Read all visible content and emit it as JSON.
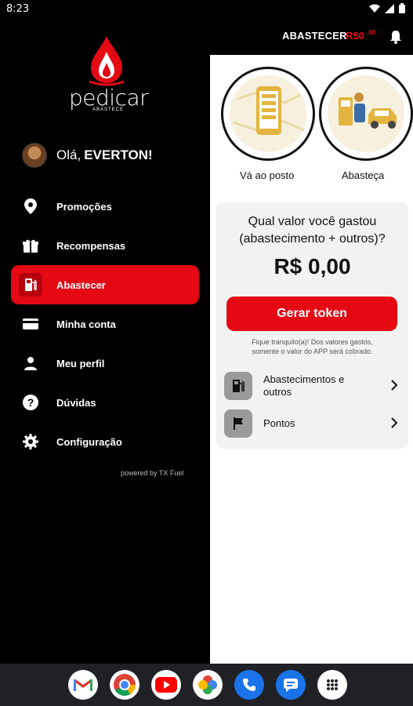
{
  "status_bar": {
    "time": "8:23",
    "icons": [
      "wifi-icon",
      "signal-icon",
      "battery-icon"
    ]
  },
  "app_bar": {
    "title": "ABASTECER",
    "balance": "R$0",
    "balance_sup": ",00",
    "bell_icon": "bell-icon"
  },
  "brand": {
    "wordmark": "pedicar",
    "subtitle": "ABASTECE",
    "accent": "#e50914"
  },
  "greeting": {
    "hello": "Olá,",
    "name": "EVERTON!"
  },
  "menu": {
    "items": [
      {
        "label": "Promoções",
        "icon": "location-pin-icon"
      },
      {
        "label": "Recompensas",
        "icon": "gift-box-icon"
      },
      {
        "label": "Abastecer",
        "icon": "fuel-pump-icon",
        "active": true
      },
      {
        "label": "Minha conta",
        "icon": "card-icon"
      },
      {
        "label": "Meu perfil",
        "icon": "person-icon"
      },
      {
        "label": "Dúvidas",
        "icon": "help-icon"
      },
      {
        "label": "Configuração",
        "icon": "gear-icon"
      }
    ]
  },
  "powered_by": "powered by TX Fuel",
  "steps": [
    {
      "label": "Vá ao posto",
      "icon": "phone-map-icon"
    },
    {
      "label": "Abasteça",
      "icon": "attendant-car-icon"
    }
  ],
  "card": {
    "question_line1": "Qual valor você gastou",
    "question_line2": "(abastecimento + outros)?",
    "amount": "R$ 0,00",
    "button": "Gerar token",
    "note_line1": "Fique tranquilo(a)! Dos valores gastos,",
    "note_line2": "somente o valor do APP será cobrado.",
    "rows": [
      {
        "label": "Abastecimentos e outros",
        "icon": "fuel-icon"
      },
      {
        "label": "Pontos",
        "icon": "flag-icon"
      }
    ]
  },
  "dock": {
    "apps": [
      "gmail-icon",
      "chrome-icon",
      "youtube-icon",
      "photos-icon",
      "phone-icon",
      "messages-icon",
      "apps-grid-icon"
    ]
  }
}
